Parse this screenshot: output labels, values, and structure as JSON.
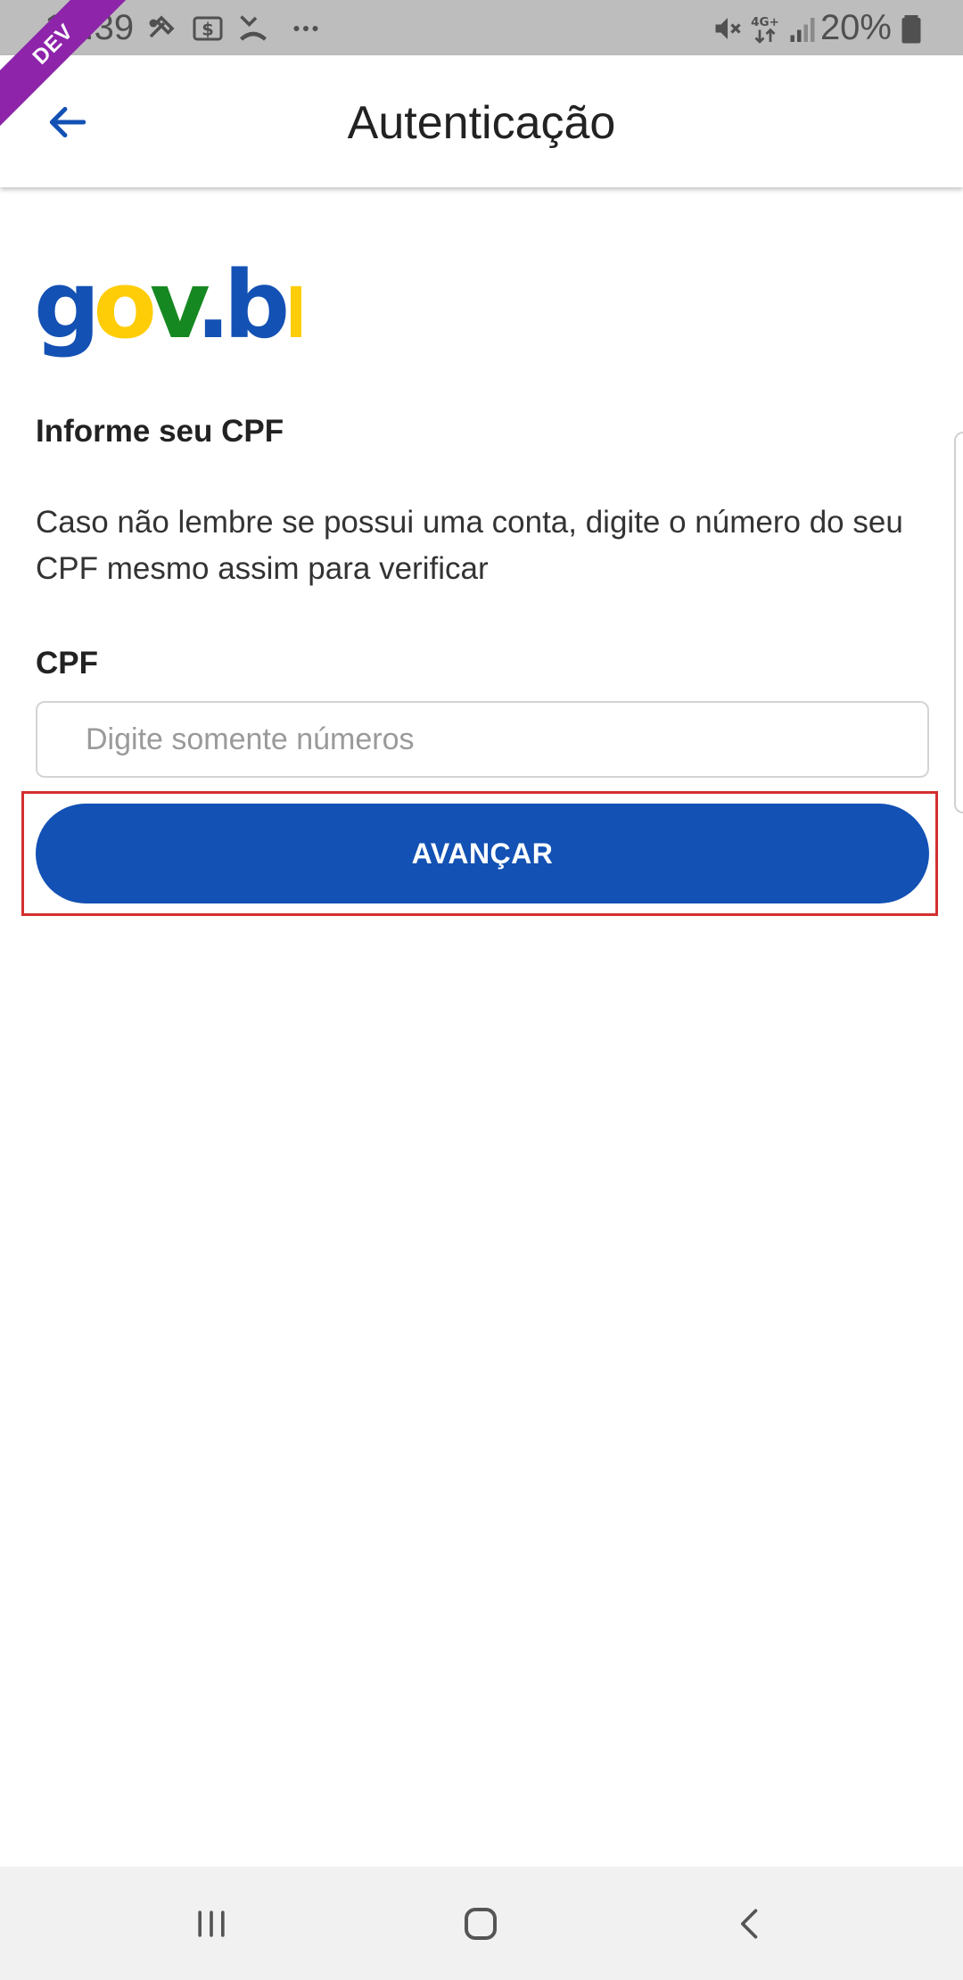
{
  "status_bar": {
    "time": "14:39",
    "battery": "20%",
    "network": "4G+",
    "dev_badge": "DEV",
    "icons": [
      "tools-icon",
      "dollar-icon",
      "missed-call-icon",
      "more-dots-icon",
      "mute-icon",
      "network-4g-icon",
      "signal-icon",
      "battery-icon"
    ]
  },
  "app_bar": {
    "title": "Autenticação",
    "back_icon": "arrow-left-icon"
  },
  "logo": {
    "text": "gov.br",
    "colors": {
      "g": "#1351b4",
      "o": "#ffcd07",
      "v": "#168821",
      "dot": "#1351b4",
      "br": "#1351b4",
      "r": "#ffcd07"
    }
  },
  "form": {
    "heading": "Informe seu CPF",
    "description": "Caso não lembre se possui uma conta, digite o número do seu CPF mesmo assim para verificar",
    "cpf_label": "CPF",
    "cpf_placeholder": "Digite somente números",
    "cpf_value": "",
    "submit_label": "AVANÇAR"
  },
  "colors": {
    "primary": "#1351b4",
    "highlight": "#d32f2f",
    "dev_ribbon": "#8e24aa"
  },
  "nav_bar": {
    "icons": [
      "recent-apps-icon",
      "home-icon",
      "back-icon"
    ]
  }
}
